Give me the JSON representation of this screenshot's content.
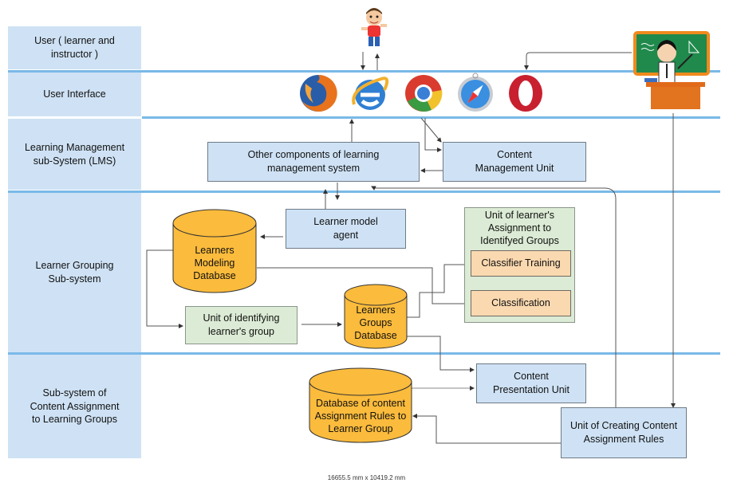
{
  "lanes": [
    {
      "label": "User ( learner and\ninstructor )"
    },
    {
      "label": "User Interface"
    },
    {
      "label": "Learning Management\nsub-System (LMS)"
    },
    {
      "label": "Learner Grouping\nSub-system"
    },
    {
      "label": "Sub-system of\nContent Assignment\nto Learning Groups"
    }
  ],
  "actors": {
    "learner": {
      "icon": "child-learner-icon"
    },
    "instructor": {
      "icon": "teacher-at-blackboard-icon"
    }
  },
  "browsers": [
    {
      "name": "Firefox",
      "icon": "firefox-icon"
    },
    {
      "name": "Internet Explorer",
      "icon": "internet-explorer-icon"
    },
    {
      "name": "Chrome",
      "icon": "chrome-icon"
    },
    {
      "name": "Safari",
      "icon": "safari-icon"
    },
    {
      "name": "Opera",
      "icon": "opera-icon"
    }
  ],
  "nodes": {
    "other_components": "Other components of learning\nmanagement system",
    "content_management": "Content\nManagement Unit",
    "learner_model_agent": "Learner model\nagent",
    "learners_modeling_db": "Learners\nModeling\nDatabase",
    "identifying_group": "Unit of identifying\nlearner's group",
    "learners_groups_db": "Learners\nGroups\nDatabase",
    "assignment_unit": "Unit of learner's\nAssignment to\nIdentifyed Groups",
    "classifier_training": "Classifier Training",
    "classification": "Classification",
    "content_presentation": "Content\nPresentation Unit",
    "rules_db": "Database of content\nAssignment Rules to\nLearner Group",
    "creating_rules": "Unit of Creating Content\nAssignment Rules"
  },
  "colors": {
    "lane": "#cfe2f5",
    "separator": "#7ab9e8",
    "database": "#fbbb3c",
    "process_green": "#dcebd5",
    "process_peach": "#fbd9b0"
  },
  "footer": "16655.5 mm x 10419.2 mm"
}
